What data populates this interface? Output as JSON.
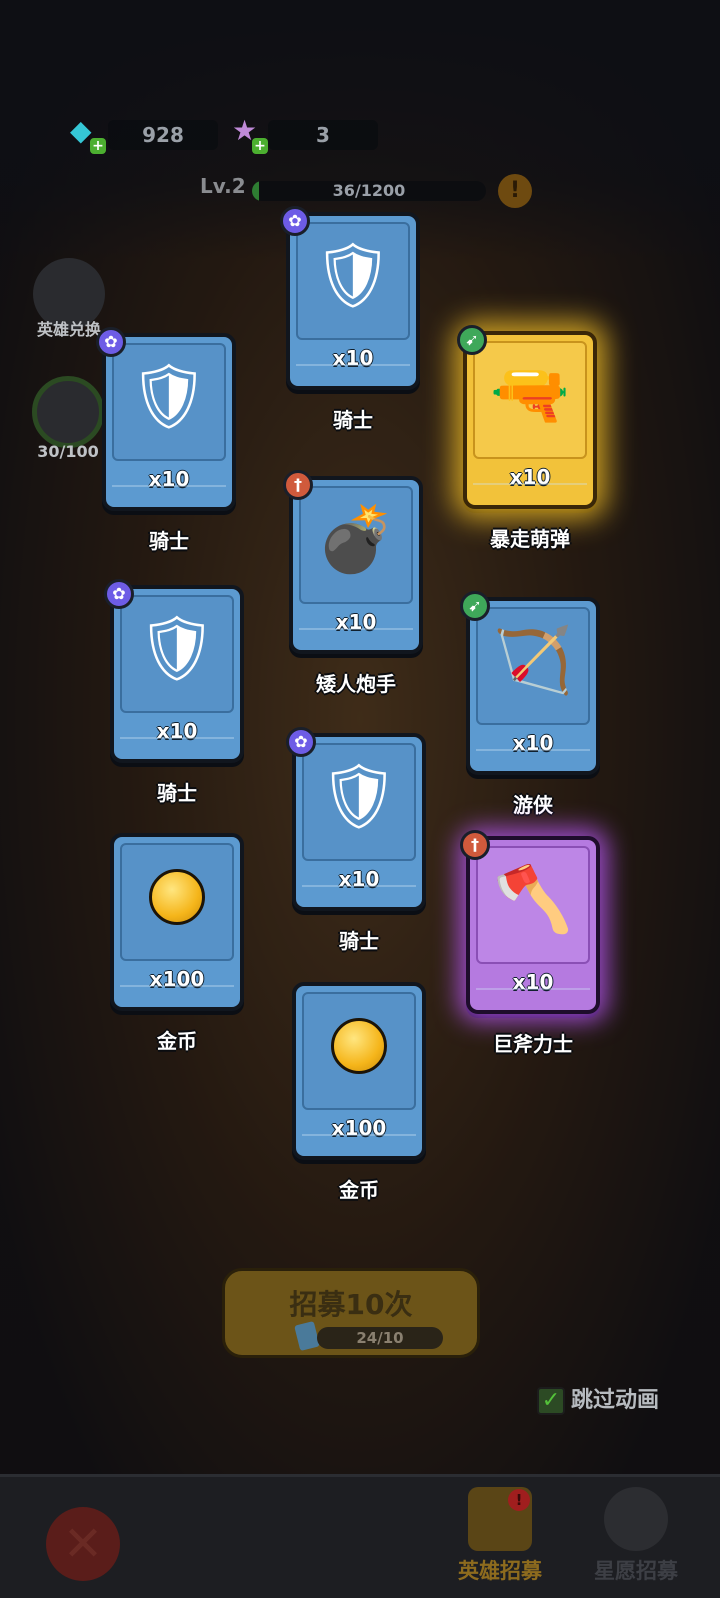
{
  "resources": {
    "gems": "928",
    "stars": "3"
  },
  "level": {
    "label": "Lv.2",
    "xp_text": "36/1200",
    "xp_fraction": 0.03
  },
  "side": {
    "hero_exchange_label": "英雄兑换",
    "star_progress": "30/100"
  },
  "cards": [
    {
      "name": "骑士",
      "qty": "x10",
      "badge": "paw",
      "icon": "knight-icon",
      "rarity": "blue"
    },
    {
      "name": "骑士",
      "qty": "x10",
      "badge": "paw",
      "icon": "knight-icon",
      "rarity": "blue"
    },
    {
      "name": "暴走萌弹",
      "qty": "x10",
      "badge": "bow",
      "icon": "gunner-icon",
      "rarity": "gold"
    },
    {
      "name": "矮人炮手",
      "qty": "x10",
      "badge": "atk",
      "icon": "dwarf-bomber-icon",
      "rarity": "blue"
    },
    {
      "name": "骑士",
      "qty": "x10",
      "badge": "paw",
      "icon": "knight-icon",
      "rarity": "blue"
    },
    {
      "name": "游侠",
      "qty": "x10",
      "badge": "bow",
      "icon": "ranger-icon",
      "rarity": "blue"
    },
    {
      "name": "骑士",
      "qty": "x10",
      "badge": "paw",
      "icon": "knight-icon",
      "rarity": "blue"
    },
    {
      "name": "金币",
      "qty": "x100",
      "badge": "",
      "icon": "coin-icon",
      "rarity": "blue"
    },
    {
      "name": "巨斧力士",
      "qty": "x10",
      "badge": "atk",
      "icon": "axe-warrior-icon",
      "rarity": "purple"
    },
    {
      "name": "金币",
      "qty": "x100",
      "badge": "",
      "icon": "coin-icon",
      "rarity": "blue"
    }
  ],
  "recruit": {
    "label": "招募10次",
    "count": "24/10"
  },
  "skip_animation": {
    "label": "跳过动画",
    "checked": true
  },
  "tabs": [
    {
      "label": "英雄招募",
      "active": true
    },
    {
      "label": "星愿招募",
      "active": false
    }
  ],
  "colors": {
    "card_blue": "#5c9ad0",
    "card_gold": "#f2c23a",
    "card_purple": "#b57ae0"
  }
}
